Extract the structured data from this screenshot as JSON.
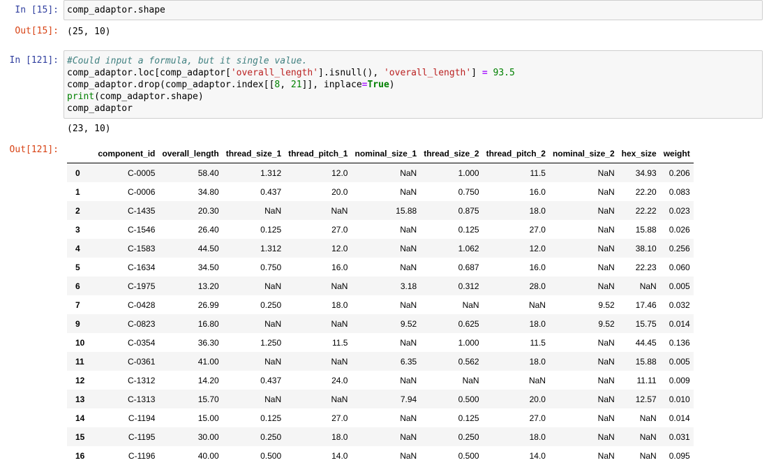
{
  "cells": {
    "c1": {
      "in_prompt": "In [15]:",
      "code": "comp_adaptor.shape",
      "out_prompt": "Out[15]:",
      "output": "(25, 10)"
    },
    "c2": {
      "in_prompt": "In [121]:",
      "code_line1": "#Could input a formula, but it single value.",
      "l2_a": "comp_adaptor.loc[comp_adaptor[",
      "l2_s1": "'overall_length'",
      "l2_b": "].isnull(), ",
      "l2_s2": "'overall_length'",
      "l2_c": "] ",
      "l2_eq": "=",
      "l2_d": " ",
      "l2_num": "93.5",
      "l3_a": "comp_adaptor.drop(comp_adaptor.index[[",
      "l3_n1": "8",
      "l3_b": ", ",
      "l3_n2": "21",
      "l3_c": "]], inplace",
      "l3_eq": "=",
      "l3_kw": "True",
      "l3_d": ")",
      "l4_fn": "print",
      "l4_rest": "(comp_adaptor.shape)",
      "l5": "comp_adaptor",
      "stdout": "(23, 10)",
      "out_prompt": "Out[121]:"
    }
  },
  "table": {
    "columns": [
      "",
      "component_id",
      "overall_length",
      "thread_size_1",
      "thread_pitch_1",
      "nominal_size_1",
      "thread_size_2",
      "thread_pitch_2",
      "nominal_size_2",
      "hex_size",
      "weight"
    ],
    "rows": [
      [
        "0",
        "C-0005",
        "58.40",
        "1.312",
        "12.0",
        "NaN",
        "1.000",
        "11.5",
        "NaN",
        "34.93",
        "0.206"
      ],
      [
        "1",
        "C-0006",
        "34.80",
        "0.437",
        "20.0",
        "NaN",
        "0.750",
        "16.0",
        "NaN",
        "22.20",
        "0.083"
      ],
      [
        "2",
        "C-1435",
        "20.30",
        "NaN",
        "NaN",
        "15.88",
        "0.875",
        "18.0",
        "NaN",
        "22.22",
        "0.023"
      ],
      [
        "3",
        "C-1546",
        "26.40",
        "0.125",
        "27.0",
        "NaN",
        "0.125",
        "27.0",
        "NaN",
        "15.88",
        "0.026"
      ],
      [
        "4",
        "C-1583",
        "44.50",
        "1.312",
        "12.0",
        "NaN",
        "1.062",
        "12.0",
        "NaN",
        "38.10",
        "0.256"
      ],
      [
        "5",
        "C-1634",
        "34.50",
        "0.750",
        "16.0",
        "NaN",
        "0.687",
        "16.0",
        "NaN",
        "22.23",
        "0.060"
      ],
      [
        "6",
        "C-1975",
        "13.20",
        "NaN",
        "NaN",
        "3.18",
        "0.312",
        "28.0",
        "NaN",
        "NaN",
        "0.005"
      ],
      [
        "7",
        "C-0428",
        "26.99",
        "0.250",
        "18.0",
        "NaN",
        "NaN",
        "NaN",
        "9.52",
        "17.46",
        "0.032"
      ],
      [
        "9",
        "C-0823",
        "16.80",
        "NaN",
        "NaN",
        "9.52",
        "0.625",
        "18.0",
        "9.52",
        "15.75",
        "0.014"
      ],
      [
        "10",
        "C-0354",
        "36.30",
        "1.250",
        "11.5",
        "NaN",
        "1.000",
        "11.5",
        "NaN",
        "44.45",
        "0.136"
      ],
      [
        "11",
        "C-0361",
        "41.00",
        "NaN",
        "NaN",
        "6.35",
        "0.562",
        "18.0",
        "NaN",
        "15.88",
        "0.005"
      ],
      [
        "12",
        "C-1312",
        "14.20",
        "0.437",
        "24.0",
        "NaN",
        "NaN",
        "NaN",
        "NaN",
        "11.11",
        "0.009"
      ],
      [
        "13",
        "C-1313",
        "15.70",
        "NaN",
        "NaN",
        "7.94",
        "0.500",
        "20.0",
        "NaN",
        "12.57",
        "0.010"
      ],
      [
        "14",
        "C-1194",
        "15.00",
        "0.125",
        "27.0",
        "NaN",
        "0.125",
        "27.0",
        "NaN",
        "NaN",
        "0.014"
      ],
      [
        "15",
        "C-1195",
        "30.00",
        "0.250",
        "18.0",
        "NaN",
        "0.250",
        "18.0",
        "NaN",
        "NaN",
        "0.031"
      ],
      [
        "16",
        "C-1196",
        "40.00",
        "0.500",
        "14.0",
        "NaN",
        "0.500",
        "14.0",
        "NaN",
        "NaN",
        "0.095"
      ]
    ]
  }
}
